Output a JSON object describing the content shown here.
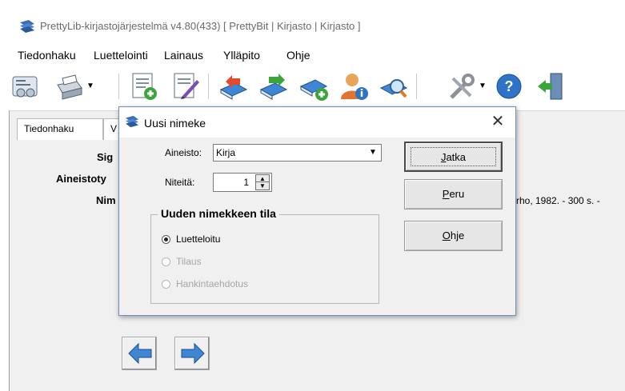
{
  "window": {
    "title": "PrettyLib-kirjastojärjestelmä v4.80(433)   [ PrettyBit | Kirjasto | Kirjasto ]",
    "icon": "prettylib-app-icon"
  },
  "menu": {
    "items": [
      "Tiedonhaku",
      "Luettelointi",
      "Lainaus",
      "Ylläpito",
      "Ohje"
    ]
  },
  "toolbar": {
    "icons": [
      "catalog-card-icon",
      "printer-icon",
      "new-record-icon",
      "edit-record-icon",
      "book-return-icon",
      "book-loan-icon",
      "book-add-icon",
      "borrower-info-icon",
      "search-book-icon",
      "tools-icon",
      "help-icon",
      "exit-icon"
    ]
  },
  "background": {
    "tabs": [
      "Tiedonhaku",
      "V"
    ],
    "field_labels": [
      "Sig",
      "Aineistoty",
      "Nim"
    ],
    "record_text": "rho, 1982. - 300 s. -"
  },
  "dialog": {
    "title": "Uusi nimeke",
    "close_glyph": "✕",
    "aineisto_label": "Aineisto:",
    "aineisto_value": "Kirja",
    "niteita_label": "Niteitä:",
    "niteita_value": "1",
    "group_title": "Uuden nimekkeen tila",
    "radios": [
      {
        "label": "Luetteloitu",
        "selected": true,
        "enabled": true
      },
      {
        "label": "Tilaus",
        "selected": false,
        "enabled": false
      },
      {
        "label": "Hankintaehdotus",
        "selected": false,
        "enabled": false
      }
    ],
    "buttons": {
      "continue": {
        "first": "J",
        "rest": "atka"
      },
      "cancel": {
        "first": "P",
        "rest": "eru"
      },
      "help": {
        "first": "O",
        "rest": "hje"
      }
    }
  },
  "colors": {
    "accent_blue": "#2f73c8",
    "dialog_border": "#6e8fb8"
  }
}
